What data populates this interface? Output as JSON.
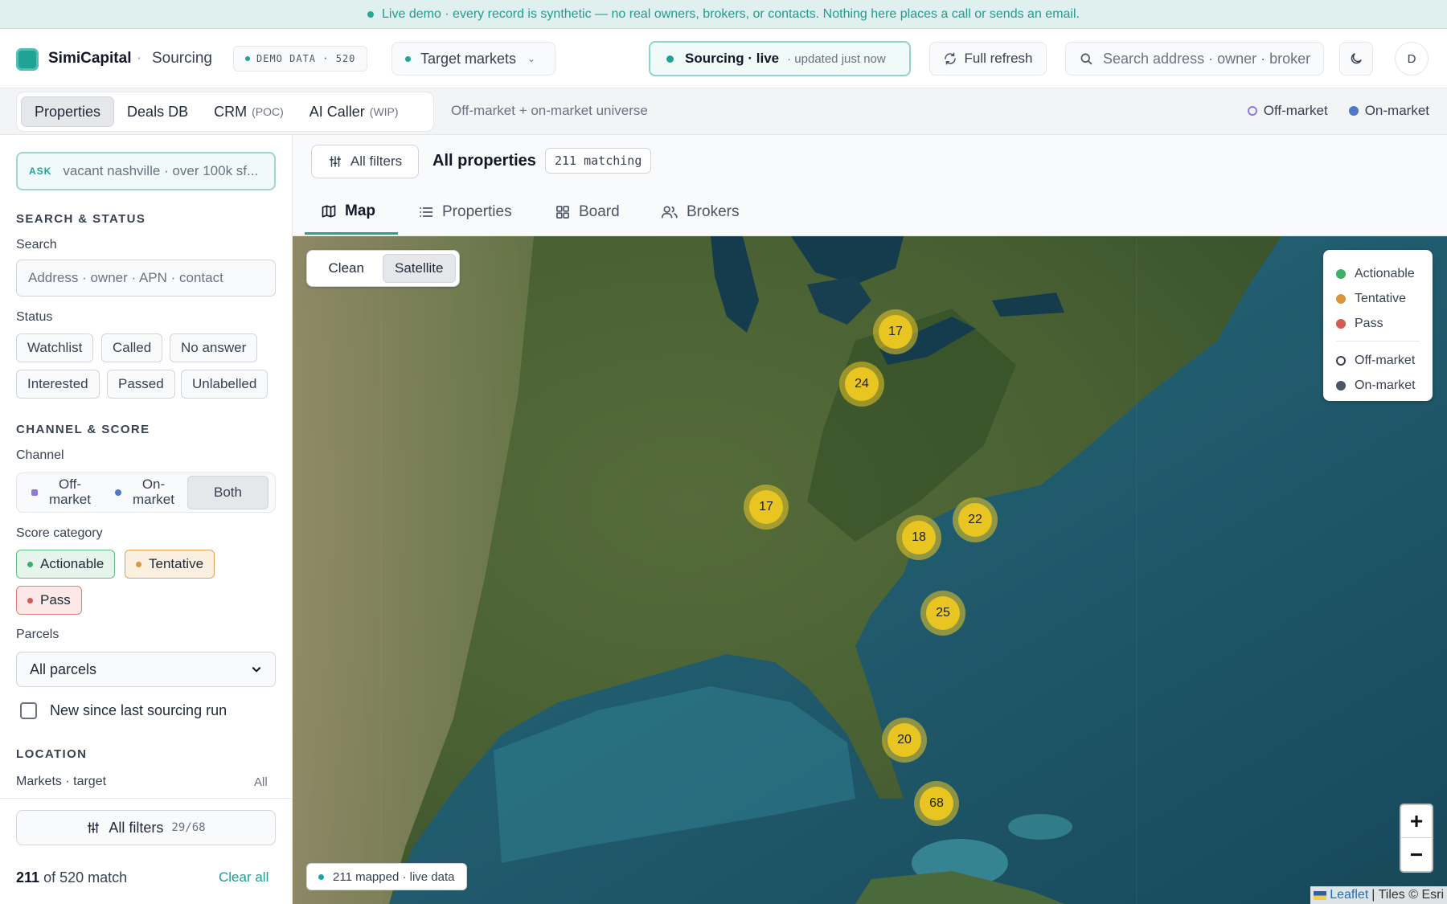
{
  "banner": {
    "text": "Live demo · every record is synthetic — no real owners, brokers, or contacts. Nothing here places a call or sends an email."
  },
  "header": {
    "brand": "SimiCapital",
    "separator": "·",
    "section": "Sourcing",
    "demo_chip": "DEMO DATA · 520",
    "markets_button": "Target markets",
    "live_label": "Sourcing · live",
    "live_updated": "· updated just now",
    "refresh_button": "Full refresh",
    "search_placeholder": "Search address · owner · broker",
    "avatar_initial": "D"
  },
  "subnav": {
    "tabs": [
      {
        "label": "Properties",
        "tag": ""
      },
      {
        "label": "Deals DB",
        "tag": ""
      },
      {
        "label": "CRM",
        "tag": "(POC)"
      },
      {
        "label": "AI Caller",
        "tag": "(WIP)"
      }
    ],
    "description": "Off-market + on-market universe",
    "legend_off": "Off-market",
    "legend_on": "On-market"
  },
  "sidebar": {
    "ask_tag": "ASK",
    "ask_placeholder": "vacant nashville · over 100k sf...",
    "search_status_title": "SEARCH & STATUS",
    "search_label": "Search",
    "search_placeholder": "Address · owner · APN · contact",
    "status_label": "Status",
    "status_options": [
      "Watchlist",
      "Called",
      "No answer",
      "Interested",
      "Passed",
      "Unlabelled"
    ],
    "channel_score_title": "CHANNEL & SCORE",
    "channel_label": "Channel",
    "channel_options": [
      "Off-market",
      "On-market",
      "Both"
    ],
    "channel_selected": "Both",
    "score_label": "Score category",
    "score_options": [
      "Actionable",
      "Tentative",
      "Pass"
    ],
    "parcels_label": "Parcels",
    "parcels_value": "All parcels",
    "new_since_label": "New since last sourcing run",
    "location_title": "LOCATION",
    "markets_label": "Markets · target",
    "markets_value": "All",
    "all_filters_label": "All filters",
    "all_filters_count": "29/68",
    "match_count": "211",
    "match_total_text": "of 520 match",
    "clear_all": "Clear all"
  },
  "main": {
    "all_filters_button": "All filters",
    "title": "All properties",
    "matching_badge": "211 matching",
    "view_tabs": [
      "Map",
      "Properties",
      "Board",
      "Brokers"
    ],
    "active_view": "Map"
  },
  "map": {
    "modes": [
      "Clean",
      "Satellite"
    ],
    "active_mode": "Satellite",
    "clusters": [
      "17",
      "24",
      "17",
      "18",
      "22",
      "25",
      "20",
      "68"
    ],
    "legend": [
      "Actionable",
      "Tentative",
      "Pass",
      "Off-market",
      "On-market"
    ],
    "zoom_in": "+",
    "zoom_out": "−",
    "mapped_status": "211 mapped · live data",
    "attribution_link": "Leaflet",
    "attribution_rest": "| Tiles © Esri"
  },
  "colors": {
    "accent": "#1fa394",
    "actionable": "#3fae6a",
    "tentative": "#d9963b",
    "pass": "#d45a54",
    "off_market": "#8b7bd8",
    "on_market": "#4f79c7",
    "cluster": "#e8c520"
  }
}
